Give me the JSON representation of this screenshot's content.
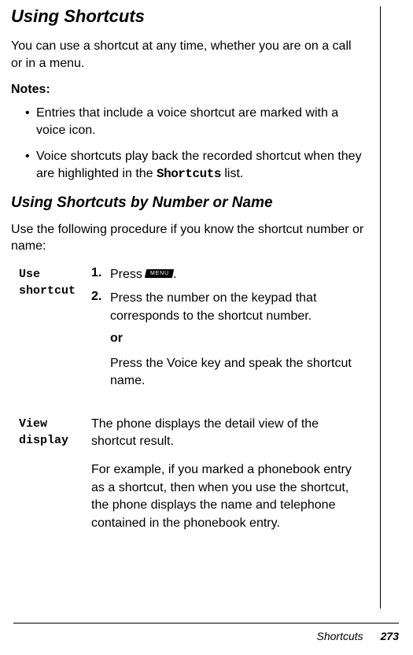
{
  "section_title": "Using Shortcuts",
  "intro_text": "You can use a shortcut at any time, whether you are on a call or in a menu.",
  "notes_label": "Notes:",
  "notes": [
    "Entries that include a voice shortcut are marked with a voice icon.",
    {
      "prefix": "Voice shortcuts play back the recorded shortcut when they are highlighted in the ",
      "mono": "Shortcuts",
      "suffix": " list."
    }
  ],
  "subsection_title": "Using Shortcuts by Number or Name",
  "subsection_intro": "Use the following procedure if you know the shortcut number or name:",
  "proc_use": {
    "label_line1": "Use",
    "label_line2": "shortcut",
    "step1_prefix": "Press ",
    "step1_key": "MENU",
    "step1_suffix": ".",
    "step2": "Press the number on the keypad that corresponds to the shortcut number.",
    "or": "or",
    "alt": "Press the Voice key and speak the shortcut name."
  },
  "proc_view": {
    "label_line1": "View",
    "label_line2": "display",
    "text1": "The phone displays the detail view of the shortcut result.",
    "text2": "For example, if you marked a phonebook entry as a shortcut, then when you use the shortcut, the phone displays the name and telephone contained in the phonebook entry."
  },
  "footer_section": "Shortcuts",
  "footer_page": "273"
}
